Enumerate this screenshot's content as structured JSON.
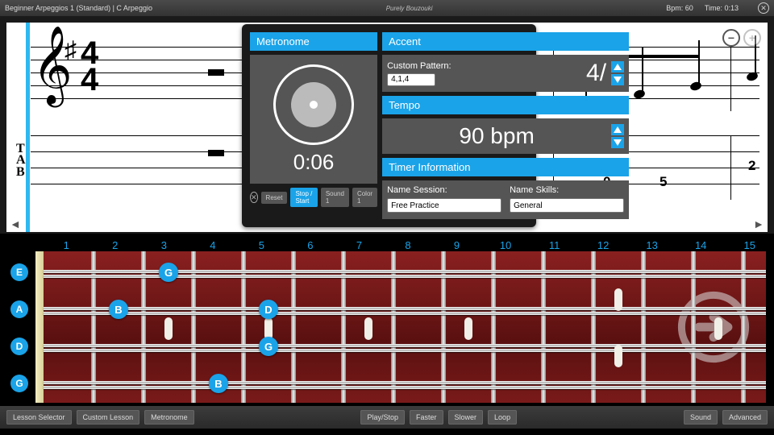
{
  "header": {
    "title": "Beginner Arpeggios 1 (Standard)  |  C Arpeggio",
    "brand": "Purely Bouzouki",
    "bpm_label": "Bpm: 60",
    "time_label": "Time: 0:13"
  },
  "score": {
    "timesig_top": "4",
    "timesig_bot": "4",
    "tab_numbers": [
      "0",
      "5",
      "2"
    ]
  },
  "metronome": {
    "title": "Metronome",
    "elapsed": "0:06",
    "buttons": {
      "reset": "Reset",
      "stopstart": "Stop / Start",
      "sound": "Sound 1",
      "color": "Color 1"
    }
  },
  "accent": {
    "title": "Accent",
    "pattern_label": "Custom Pattern:",
    "pattern_value": "4,1,4",
    "display": "4/"
  },
  "tempo": {
    "title": "Tempo",
    "display": "90 bpm"
  },
  "timer": {
    "title": "Timer Information",
    "session_label": "Name Session:",
    "skills_label": "Name Skills:",
    "session_value": "Free Practice",
    "skills_value": "General"
  },
  "frets": {
    "numbers": [
      "1",
      "2",
      "3",
      "4",
      "5",
      "6",
      "7",
      "8",
      "9",
      "10",
      "11",
      "12",
      "13",
      "14",
      "15"
    ],
    "open_strings": [
      "E",
      "A",
      "D",
      "G"
    ],
    "markers": [
      {
        "string": 0,
        "fret": 3,
        "label": "G"
      },
      {
        "string": 1,
        "fret": 2,
        "label": "B"
      },
      {
        "string": 1,
        "fret": 5,
        "label": "D"
      },
      {
        "string": 2,
        "fret": 5,
        "label": "G"
      },
      {
        "string": 3,
        "fret": 4,
        "label": "B"
      }
    ]
  },
  "bottom": {
    "left": [
      "Lesson Selector",
      "Custom Lesson",
      "Metronome"
    ],
    "center": [
      "Play/Stop",
      "Faster",
      "Slower",
      "Loop"
    ],
    "right": [
      "Sound",
      "Advanced"
    ]
  }
}
